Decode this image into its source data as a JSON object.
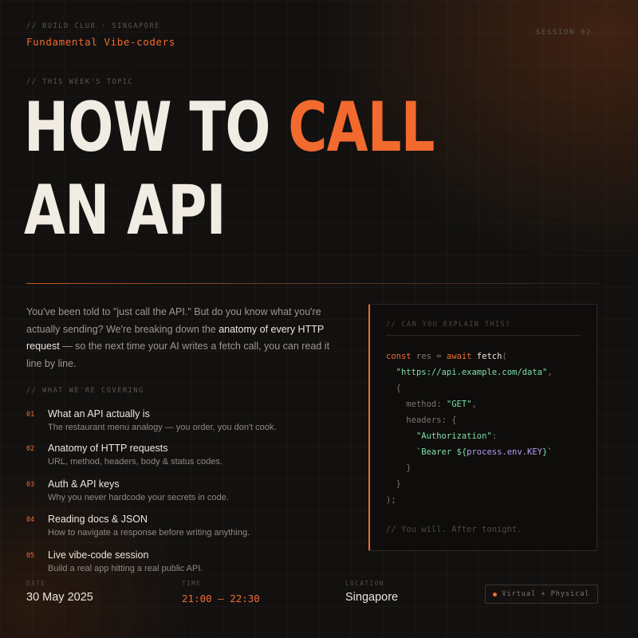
{
  "header": {
    "club": "// BUILD CLUB · SINGAPORE",
    "org": "Fundamental Vibe-coders",
    "session": "SESSION 02"
  },
  "topic_label": "// THIS WEEK'S TOPIC",
  "headline": {
    "line1_a": "HOW TO ",
    "line1_b": "CALL",
    "line2": "AN API"
  },
  "intro": {
    "part1": "You've been told to \"just call the API.\" But do you know what you're actually sending? We're breaking down the ",
    "highlight": "anatomy of every HTTP request",
    "part2": " — so the next time your AI writes a fetch call, you can read it line by line."
  },
  "covering_label": "// WHAT WE'RE COVERING",
  "items": [
    {
      "num": "01",
      "title": "What an API actually is",
      "desc": "The restaurant menu analogy — you order, you don't cook."
    },
    {
      "num": "02",
      "title": "Anatomy of HTTP requests",
      "desc": "URL, method, headers, body & status codes."
    },
    {
      "num": "03",
      "title": "Auth & API keys",
      "desc": "Why you never hardcode your secrets in code."
    },
    {
      "num": "04",
      "title": "Reading docs & JSON",
      "desc": "How to navigate a response before writing anything."
    },
    {
      "num": "05",
      "title": "Live vibe-code session",
      "desc": "Build a real app hitting a real public API."
    }
  ],
  "code_card": {
    "label": "// CAN YOU EXPLAIN THIS?",
    "kw_const": "const",
    "var_res": " res = ",
    "kw_await": "await",
    "fn_fetch": " fetch",
    "paren_open": "(",
    "url": "\"https://api.example.com/data\"",
    "comma": ",",
    "brace_open": "{",
    "method_key": "method: ",
    "method_val": "\"GET\"",
    "headers_key": "headers: {",
    "auth_key": "\"Authorization\"",
    "colon": ":",
    "bearer_a": "`Bearer ${",
    "bearer_b": "process.env.KEY",
    "bearer_c": "}`",
    "brace_close": "}",
    "close": ");",
    "footer": "// You will. After tonight."
  },
  "meta": {
    "date_label": "DATE",
    "date": "30 May 2025",
    "time_label": "TIME",
    "time": "21:00 – 22:30",
    "location_label": "LOCATION",
    "location": "Singapore",
    "badge": "Virtual + Physical"
  },
  "colors": {
    "accent": "#f26a2e",
    "background": "#121110",
    "text": "#f1ece3",
    "string": "#7fe0a7",
    "variable": "#b29df0"
  }
}
